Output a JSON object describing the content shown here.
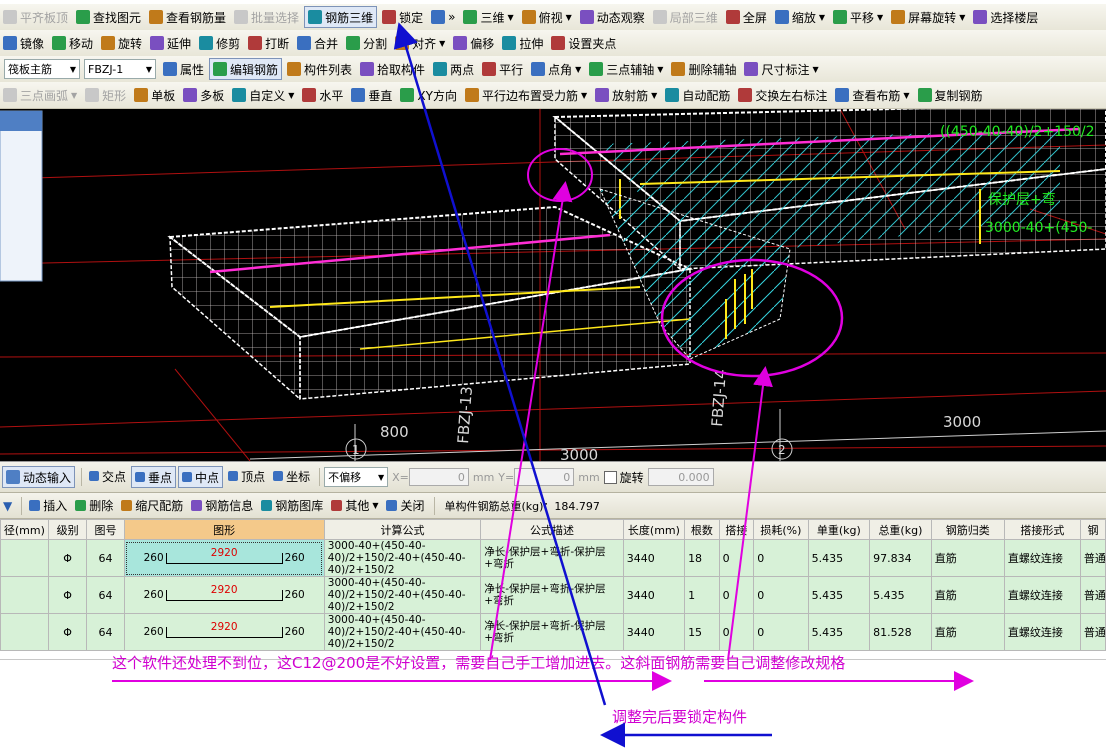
{
  "toolbar1": {
    "items": [
      {
        "label": "平齐板顶",
        "icon": "align-top-icon",
        "disabled": true
      },
      {
        "label": "查找图元",
        "icon": "find-icon"
      },
      {
        "label": "查看钢筋量",
        "icon": "rebar-qty-icon"
      },
      {
        "label": "批量选择",
        "icon": "batch-select-icon",
        "disabled": true
      },
      {
        "label": "钢筋三维",
        "icon": "rebar-3d-icon",
        "active": true
      },
      {
        "label": "锁定",
        "icon": "lock-icon"
      },
      {
        "label": "»",
        "icon": "more-icon"
      },
      {
        "label": "三维",
        "icon": "3d-icon",
        "dropdown": true
      },
      {
        "label": "俯视",
        "icon": "top-view-icon",
        "dropdown": true
      },
      {
        "label": "动态观察",
        "icon": "orbit-icon"
      },
      {
        "label": "局部三维",
        "icon": "local-3d-icon",
        "disabled": true
      },
      {
        "label": "全屏",
        "icon": "fullscreen-icon"
      },
      {
        "label": "缩放",
        "icon": "zoom-icon",
        "dropdown": true
      },
      {
        "label": "平移",
        "icon": "pan-icon",
        "dropdown": true
      },
      {
        "label": "屏幕旋转",
        "icon": "rotate-screen-icon",
        "dropdown": true
      },
      {
        "label": "选择楼层",
        "icon": "floor-select-icon"
      }
    ]
  },
  "toolbar2": {
    "items": [
      {
        "label": "镜像",
        "icon": "mirror-icon"
      },
      {
        "label": "移动",
        "icon": "move-icon"
      },
      {
        "label": "旋转",
        "icon": "rotate-icon"
      },
      {
        "label": "延伸",
        "icon": "extend-icon"
      },
      {
        "label": "修剪",
        "icon": "trim-icon"
      },
      {
        "label": "打断",
        "icon": "break-icon"
      },
      {
        "label": "合并",
        "icon": "merge-icon"
      },
      {
        "label": "分割",
        "icon": "split-icon"
      },
      {
        "label": "对齐",
        "icon": "align-icon",
        "dropdown": true
      },
      {
        "label": "偏移",
        "icon": "offset-icon"
      },
      {
        "label": "拉伸",
        "icon": "stretch-icon"
      },
      {
        "label": "设置夹点",
        "icon": "grip-icon"
      }
    ]
  },
  "toolbar3": {
    "type_select": "筏板主筋",
    "id_select": "FBZJ-1",
    "items": [
      {
        "label": "属性",
        "icon": "properties-icon"
      },
      {
        "label": "编辑钢筋",
        "icon": "edit-rebar-icon",
        "active": true
      },
      {
        "label": "构件列表",
        "icon": "component-list-icon"
      },
      {
        "label": "拾取构件",
        "icon": "pick-component-icon"
      },
      {
        "label": "两点",
        "icon": "two-point-icon"
      },
      {
        "label": "平行",
        "icon": "parallel-icon"
      },
      {
        "label": "点角",
        "icon": "point-angle-icon",
        "dropdown": true
      },
      {
        "label": "三点辅轴",
        "icon": "three-point-axis-icon",
        "dropdown": true
      },
      {
        "label": "删除辅轴",
        "icon": "delete-axis-icon"
      },
      {
        "label": "尺寸标注",
        "icon": "dimension-icon",
        "dropdown": true
      }
    ]
  },
  "toolbar4": {
    "items": [
      {
        "label": "三点画弧",
        "icon": "arc-icon",
        "dropdown": true,
        "disabled": true
      },
      {
        "label": "矩形",
        "icon": "rect-icon",
        "disabled": true
      },
      {
        "label": "单板",
        "icon": "single-slab-icon"
      },
      {
        "label": "多板",
        "icon": "multi-slab-icon"
      },
      {
        "label": "自定义",
        "icon": "custom-icon",
        "dropdown": true
      },
      {
        "label": "水平",
        "icon": "horizontal-icon"
      },
      {
        "label": "垂直",
        "icon": "vertical-icon"
      },
      {
        "label": "XY方向",
        "icon": "xy-direction-icon"
      },
      {
        "label": "平行边布置受力筋",
        "icon": "parallel-edge-icon",
        "dropdown": true
      },
      {
        "label": "放射筋",
        "icon": "radial-rebar-icon",
        "dropdown": true
      },
      {
        "label": "自动配筋",
        "icon": "auto-rebar-icon"
      },
      {
        "label": "交换左右标注",
        "icon": "swap-label-icon"
      },
      {
        "label": "查看布筋",
        "icon": "view-rebar-icon",
        "dropdown": true
      },
      {
        "label": "复制钢筋",
        "icon": "copy-rebar-icon"
      }
    ]
  },
  "viewport": {
    "labels": [
      {
        "text": "((450-40-40)/2+150/2",
        "color": "#22ee22"
      },
      {
        "text": "保护层+弯",
        "color": "#22ee22"
      },
      {
        "text": "3000-40+(450-",
        "color": "#22ee22"
      },
      {
        "text": "FBZJ-13",
        "color": "#d8d8d8"
      },
      {
        "text": "FBZJ-14",
        "color": "#d8d8d8"
      },
      {
        "text": "800",
        "color": "#d8d8d8"
      },
      {
        "text": "3000",
        "color": "#d8d8d8"
      },
      {
        "text": "3000",
        "color": "#d8d8d8"
      },
      {
        "text": "1",
        "color": "#d8d8d8"
      },
      {
        "text": "2",
        "color": "#d8d8d8"
      }
    ]
  },
  "snapbar": {
    "dynamic_input": "动态输入",
    "items": [
      "交点",
      "垂点",
      "中点",
      "顶点",
      "坐标"
    ],
    "offset_select": "不偏移",
    "x_label": "X=",
    "x_value": "0",
    "x_unit": "mm",
    "y_label": "Y=",
    "y_value": "0",
    "y_unit": "mm",
    "rotate_label": "旋转",
    "rotate_value": "0.000"
  },
  "rebarbar": {
    "items": [
      "插入",
      "删除",
      "缩尺配筋",
      "钢筋信息",
      "钢筋图库",
      "其他",
      "关闭"
    ],
    "total": "单构件钢筋总重(kg)：184.797"
  },
  "grid": {
    "headers": [
      "径(mm)",
      "级别",
      "图号",
      "图形",
      "计算公式",
      "公式描述",
      "长度(mm)",
      "根数",
      "搭接",
      "损耗(%)",
      "单重(kg)",
      "总重(kg)",
      "钢筋归类",
      "搭接形式",
      "钢"
    ],
    "rows": [
      {
        "dia": "",
        "grade": "Φ",
        "fig": "64",
        "left": "260",
        "mid": "2920",
        "right": "260",
        "formula": "3000-40+(450-40-40)/2+150/2-40+(450-40-40)/2+150/2",
        "desc": "净长-保护层+弯折-保护层+弯折",
        "len": "3440",
        "count": "18",
        "lap": "0",
        "loss": "0",
        "unit": "5.435",
        "total": "97.834",
        "cat": "直筋",
        "laptype": "直螺纹连接",
        "last": "普通"
      },
      {
        "dia": "",
        "grade": "Φ",
        "fig": "64",
        "left": "260",
        "mid": "2920",
        "right": "260",
        "formula": "3000-40+(450-40-40)/2+150/2-40+(450-40-40)/2+150/2",
        "desc": "净长-保护层+弯折-保护层+弯折",
        "len": "3440",
        "count": "1",
        "lap": "0",
        "loss": "0",
        "unit": "5.435",
        "total": "5.435",
        "cat": "直筋",
        "laptype": "直螺纹连接",
        "last": "普通"
      },
      {
        "dia": "",
        "grade": "Φ",
        "fig": "64",
        "left": "260",
        "mid": "2920",
        "right": "260",
        "formula": "3000-40+(450-40-40)/2+150/2-40+(450-40-40)/2+150/2",
        "desc": "净长-保护层+弯折-保护层+弯折",
        "len": "3440",
        "count": "15",
        "lap": "0",
        "loss": "0",
        "unit": "5.435",
        "total": "81.528",
        "cat": "直筋",
        "laptype": "直螺纹连接",
        "last": "普通"
      }
    ]
  },
  "annotations": {
    "note1": "这个软件还处理不到位，这C12@200是不好设置，需要自己手工增加进去。这斜面钢筋需要自己调整修改规格",
    "note2": "调整完后要锁定构件"
  }
}
